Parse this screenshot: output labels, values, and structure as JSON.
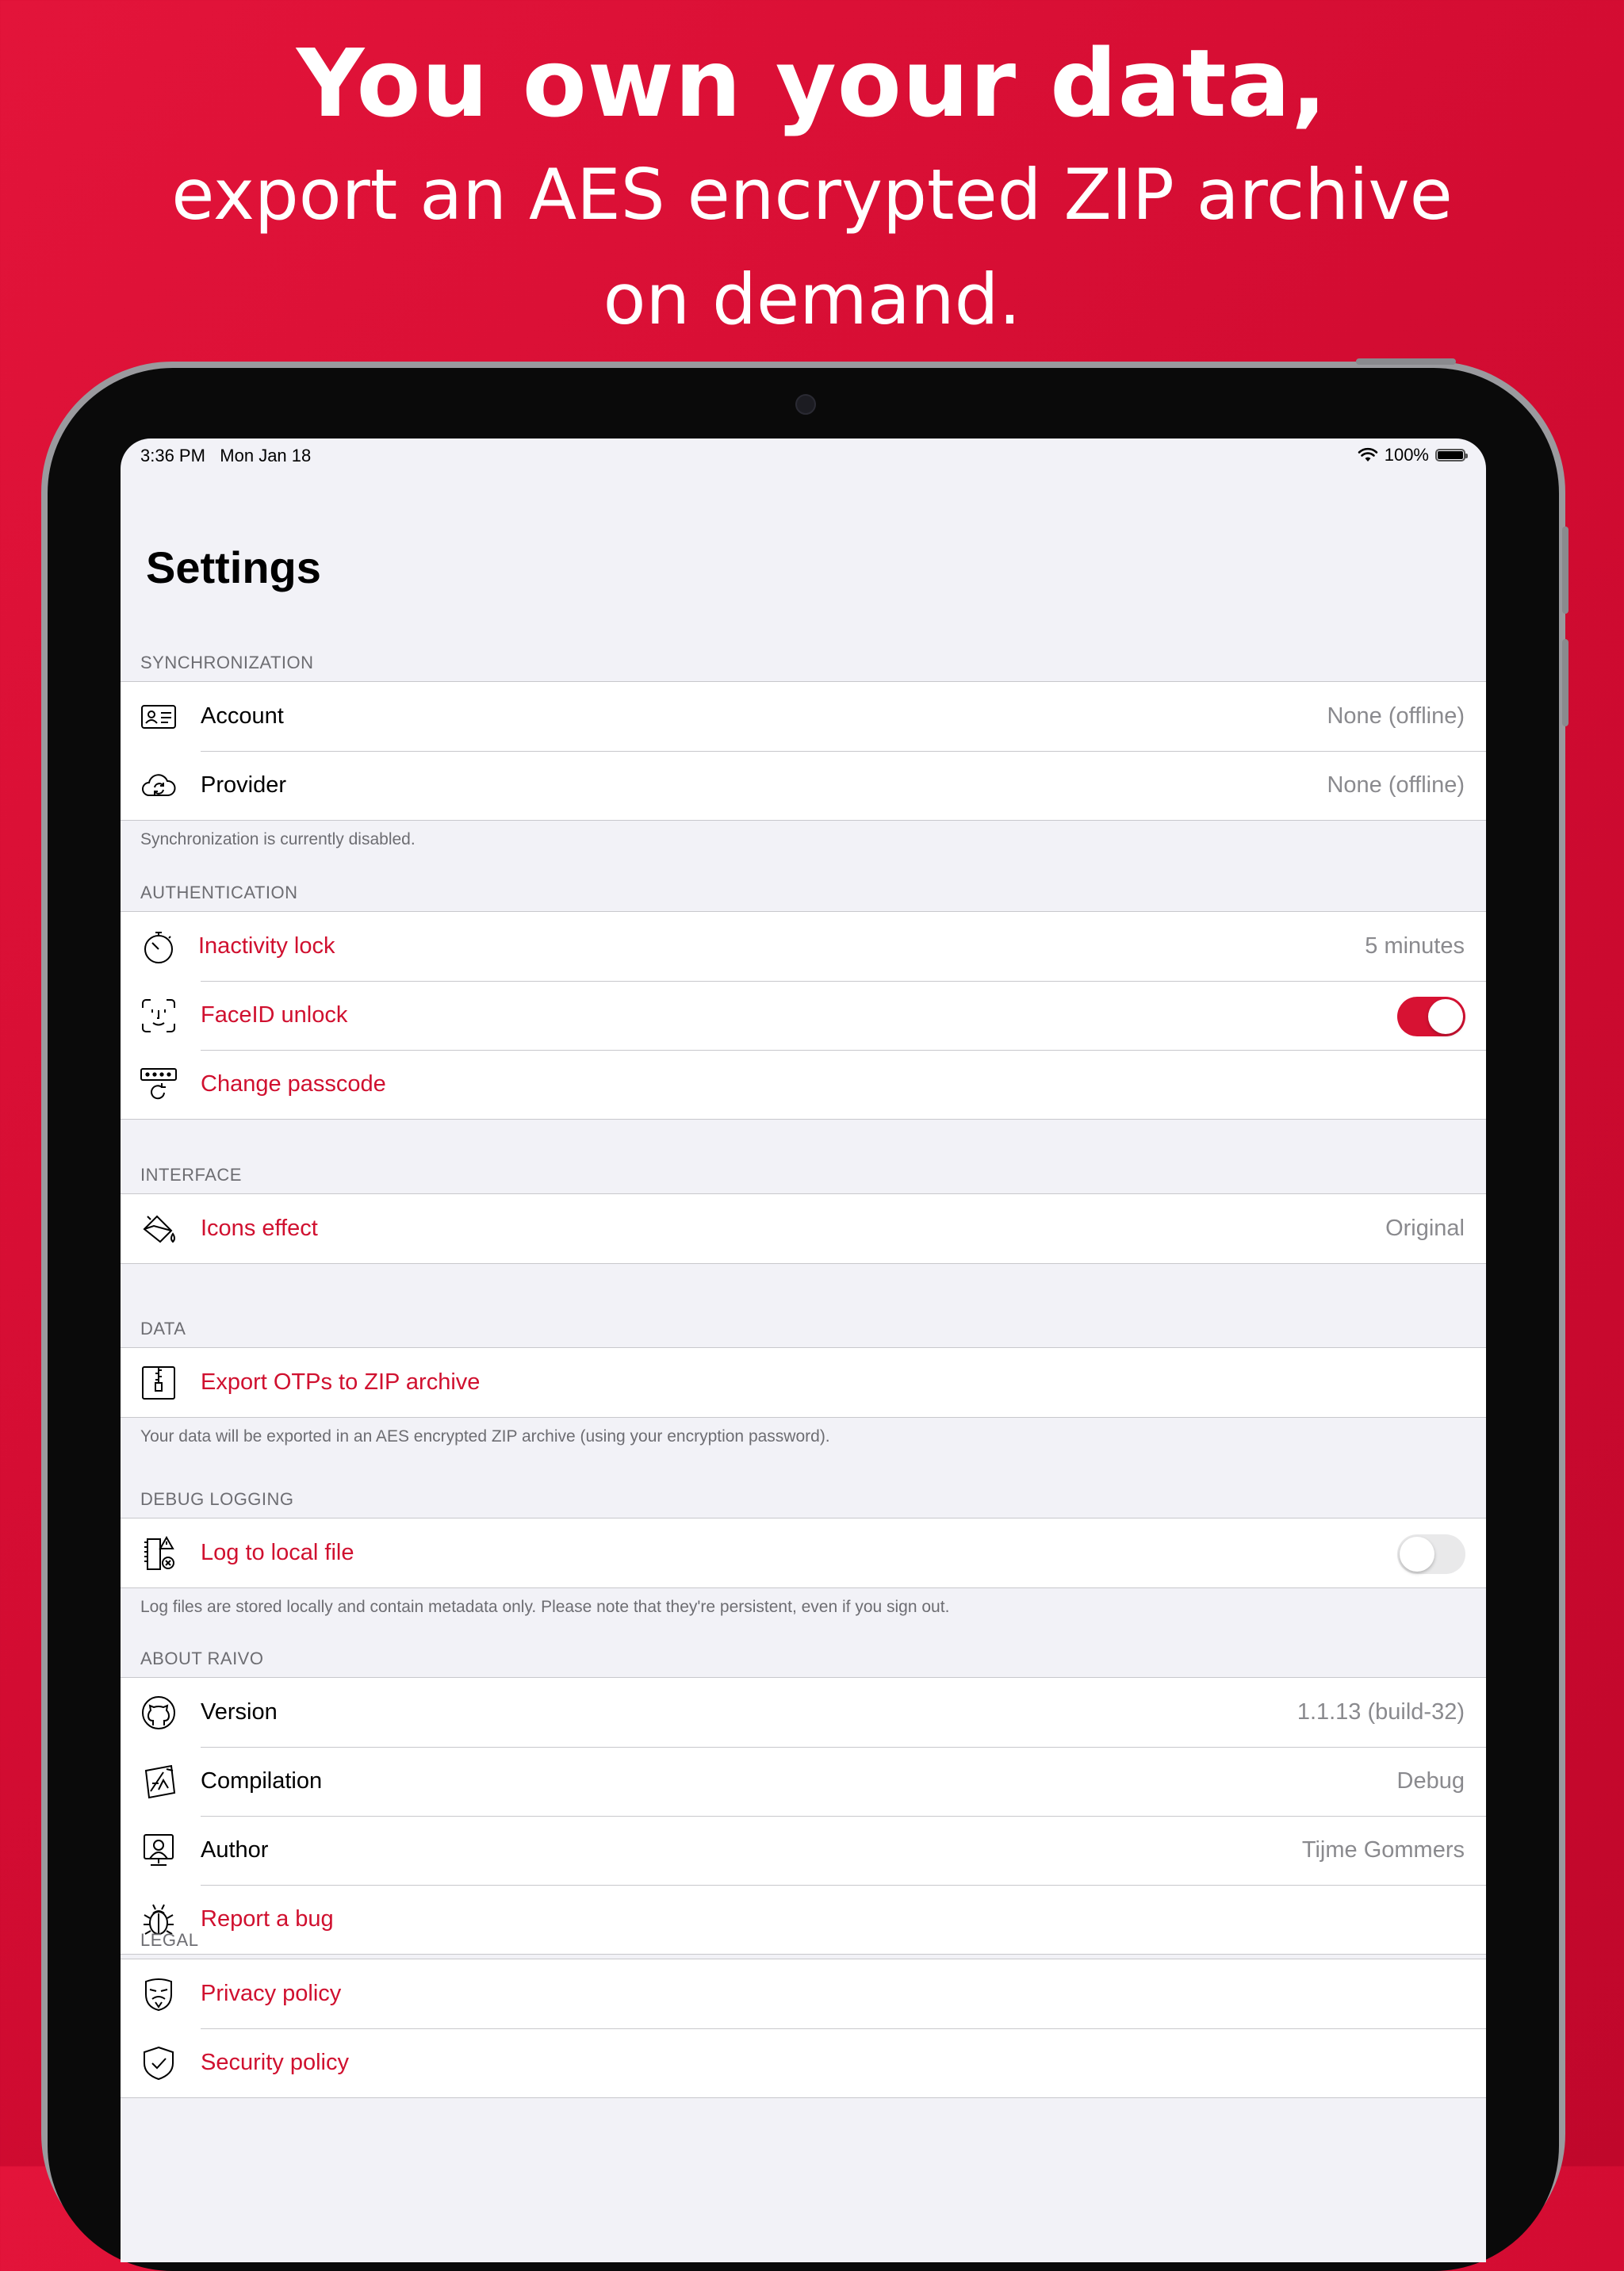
{
  "headline": {
    "line1": "You own your data,",
    "line2": "export an AES encrypted ZIP archive on demand."
  },
  "status_bar": {
    "time": "3:36 PM",
    "date": "Mon Jan 18",
    "battery": "100%"
  },
  "page_title": "Settings",
  "sections": {
    "synchronization": {
      "header": "SYNCHRONIZATION",
      "account_label": "Account",
      "account_value": "None (offline)",
      "provider_label": "Provider",
      "provider_value": "None (offline)",
      "footer": "Synchronization is currently disabled."
    },
    "authentication": {
      "header": "AUTHENTICATION",
      "inactivity_label": "Inactivity lock",
      "inactivity_value": "5 minutes",
      "faceid_label": "FaceID unlock",
      "faceid_enabled": true,
      "passcode_label": "Change passcode"
    },
    "interface": {
      "header": "INTERFACE",
      "icons_label": "Icons effect",
      "icons_value": "Original"
    },
    "data": {
      "header": "DATA",
      "export_label": "Export OTPs to ZIP archive",
      "footer": "Your data will be exported in an AES encrypted ZIP archive (using your encryption password)."
    },
    "debug": {
      "header": "DEBUG LOGGING",
      "log_label": "Log to local file",
      "log_enabled": false,
      "footer": "Log files are stored locally and contain metadata only. Please note that they're persistent, even if you sign out."
    },
    "about": {
      "header": "ABOUT RAIVO",
      "version_label": "Version",
      "version_value": "1.1.13 (build-32)",
      "compilation_label": "Compilation",
      "compilation_value": "Debug",
      "author_label": "Author",
      "author_value": "Tijme Gommers",
      "bug_label": "Report a bug"
    },
    "legal": {
      "header": "LEGAL",
      "privacy_label": "Privacy policy",
      "security_label": "Security policy"
    }
  },
  "colors": {
    "accent": "#d0102f",
    "background_red": "#d30c32",
    "toggle_on": "#d71233"
  }
}
